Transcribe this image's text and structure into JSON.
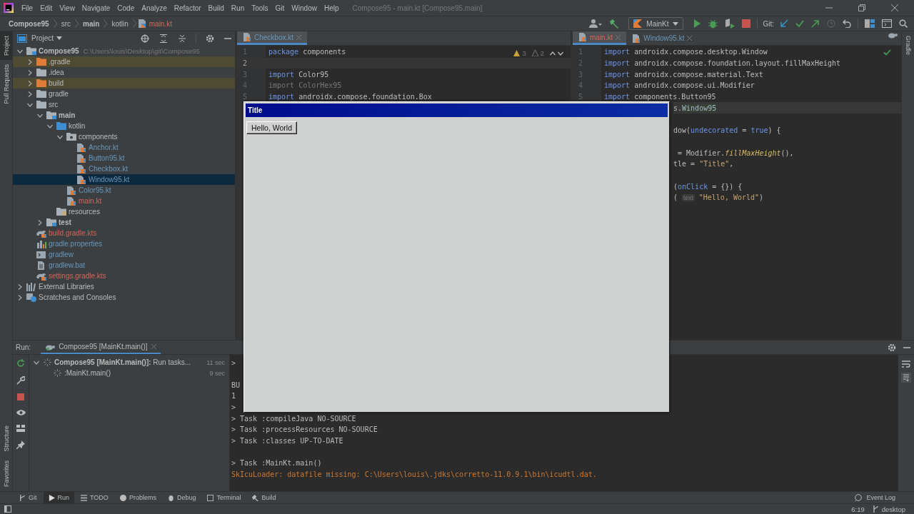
{
  "menu_bar": {
    "items": [
      "File",
      "Edit",
      "View",
      "Navigate",
      "Code",
      "Analyze",
      "Refactor",
      "Build",
      "Run",
      "Tools",
      "Git",
      "Window",
      "Help"
    ],
    "title": "Compose95 - main.kt [Compose95.main]"
  },
  "breadcrumbs": [
    {
      "label": "Compose95",
      "kind": "project"
    },
    {
      "label": "src",
      "kind": "dir"
    },
    {
      "label": "main",
      "kind": "module"
    },
    {
      "label": "kotlin",
      "kind": "dir"
    },
    {
      "label": "main.kt",
      "kind": "file"
    }
  ],
  "toolbar": {
    "run_config": "MainKt",
    "git_label": "Git:"
  },
  "side_stripe": {
    "top": [
      {
        "label": "Project",
        "selected": true
      },
      {
        "label": "Pull Requests",
        "selected": false
      }
    ],
    "bottom": [
      {
        "label": "Structure",
        "selected": false
      },
      {
        "label": "Favorites",
        "selected": false
      }
    ],
    "right": [
      {
        "label": "Gradle",
        "selected": false
      }
    ]
  },
  "project": {
    "title": "Project",
    "tree": [
      {
        "name": "Compose95",
        "kind": "module",
        "path": "C:\\Users\\louis\\Desktop\\git\\Compose95",
        "expanded": true,
        "changed": false,
        "unversioned": false,
        "selected": false,
        "excluded": false,
        "children": [
          {
            "name": ".gradle",
            "kind": "folder-excluded",
            "expanded": false,
            "changed": false,
            "unversioned": false,
            "selected": false,
            "excluded": true
          },
          {
            "name": ".idea",
            "kind": "folder",
            "expanded": false,
            "changed": false,
            "unversioned": false,
            "selected": false,
            "excluded": false
          },
          {
            "name": "build",
            "kind": "folder-excluded",
            "expanded": false,
            "changed": false,
            "unversioned": false,
            "selected": false,
            "excluded": true
          },
          {
            "name": "gradle",
            "kind": "folder",
            "expanded": false,
            "changed": false,
            "unversioned": false,
            "selected": false,
            "excluded": false
          },
          {
            "name": "src",
            "kind": "folder",
            "expanded": true,
            "changed": false,
            "unversioned": false,
            "selected": false,
            "excluded": false,
            "children": [
              {
                "name": "main",
                "kind": "module",
                "expanded": true,
                "changed": false,
                "unversioned": false,
                "selected": false,
                "excluded": false,
                "children": [
                  {
                    "name": "kotlin",
                    "kind": "source-folder",
                    "expanded": true,
                    "changed": false,
                    "unversioned": false,
                    "selected": false,
                    "excluded": false,
                    "children": [
                      {
                        "name": "components",
                        "kind": "package",
                        "expanded": true,
                        "changed": false,
                        "unversioned": false,
                        "selected": false,
                        "excluded": false,
                        "children": [
                          {
                            "name": "Anchor.kt",
                            "kind": "kotlin",
                            "changed": true,
                            "unversioned": false,
                            "selected": false,
                            "excluded": false
                          },
                          {
                            "name": "Button95.kt",
                            "kind": "kotlin",
                            "changed": true,
                            "unversioned": false,
                            "selected": false,
                            "excluded": false
                          },
                          {
                            "name": "Checkbox.kt",
                            "kind": "kotlin",
                            "changed": true,
                            "unversioned": false,
                            "selected": false,
                            "excluded": false
                          },
                          {
                            "name": "Window95.kt",
                            "kind": "kotlin",
                            "changed": true,
                            "unversioned": false,
                            "selected": true,
                            "excluded": false
                          }
                        ]
                      },
                      {
                        "name": "Color95.kt",
                        "kind": "kotlin",
                        "changed": true,
                        "unversioned": false,
                        "selected": false,
                        "excluded": false
                      },
                      {
                        "name": "main.kt",
                        "kind": "kotlin",
                        "changed": false,
                        "unversioned": true,
                        "selected": false,
                        "excluded": false
                      }
                    ]
                  },
                  {
                    "name": "resources",
                    "kind": "resources-folder",
                    "changed": false,
                    "unversioned": false,
                    "selected": false,
                    "excluded": false
                  }
                ]
              },
              {
                "name": "test",
                "kind": "module",
                "expanded": false,
                "changed": false,
                "unversioned": false,
                "selected": false,
                "excluded": false
              }
            ]
          },
          {
            "name": "build.gradle.kts",
            "kind": "gradle",
            "changed": false,
            "unversioned": true,
            "selected": false,
            "excluded": false
          },
          {
            "name": "gradle.properties",
            "kind": "properties",
            "changed": true,
            "unversioned": false,
            "selected": false,
            "excluded": false
          },
          {
            "name": "gradlew",
            "kind": "shell",
            "changed": true,
            "unversioned": false,
            "selected": false,
            "excluded": false
          },
          {
            "name": "gradlew.bat",
            "kind": "bat",
            "changed": true,
            "unversioned": false,
            "selected": false,
            "excluded": false
          },
          {
            "name": "settings.gradle.kts",
            "kind": "gradle",
            "changed": false,
            "unversioned": true,
            "selected": false,
            "excluded": false
          }
        ]
      },
      {
        "name": "External Libraries",
        "kind": "libraries",
        "expanded": false,
        "changed": false,
        "unversioned": false,
        "selected": false,
        "excluded": false
      },
      {
        "name": "Scratches and Consoles",
        "kind": "scratches",
        "expanded": false,
        "changed": false,
        "unversioned": false,
        "selected": false,
        "excluded": false
      }
    ]
  },
  "editors": [
    {
      "tabs": [
        {
          "label": "Checkbox.kt",
          "changed": true,
          "unversioned": false,
          "selected": true
        }
      ],
      "inspections": {
        "warnings": "3",
        "weak_warnings": "2"
      },
      "lines": [
        {
          "number": "1",
          "kind": "full",
          "current": false,
          "segments": [
            {
              "text": "package",
              "kind": "kw"
            },
            {
              "text": " components",
              "kind": "plain"
            }
          ]
        },
        {
          "number": "2",
          "kind": "full",
          "current": true
        },
        {
          "number": "3",
          "kind": "full",
          "current": false,
          "segments": [
            {
              "text": "import",
              "kind": "kw"
            },
            {
              "text": " Color95",
              "kind": "plain"
            }
          ]
        },
        {
          "number": "4",
          "kind": "full",
          "current": false,
          "segments": [
            {
              "text": "import ColorHex95",
              "kind": "dim"
            }
          ]
        },
        {
          "number": "5",
          "kind": "full",
          "current": false,
          "segments": [
            {
              "text": "import",
              "kind": "kw"
            },
            {
              "text": " androidx.compose.foundation.Box",
              "kind": "plain"
            }
          ]
        }
      ]
    },
    {
      "tabs": [
        {
          "label": "main.kt",
          "changed": false,
          "unversioned": true,
          "selected": true
        },
        {
          "label": "Window95.kt",
          "changed": true,
          "unversioned": false,
          "selected": false
        }
      ],
      "lines": [
        {
          "number": "1",
          "kind": "full",
          "current": false,
          "segments": [
            {
              "text": "import",
              "kind": "kw"
            },
            {
              "text": " androidx.compose.desktop.Window",
              "kind": "plain"
            }
          ]
        },
        {
          "number": "2",
          "kind": "full",
          "current": false,
          "segments": [
            {
              "text": "import",
              "kind": "kw"
            },
            {
              "text": " androidx.compose.foundation.layout.fillMaxHeight",
              "kind": "plain"
            }
          ]
        },
        {
          "number": "3",
          "kind": "full",
          "current": false,
          "segments": [
            {
              "text": "import",
              "kind": "kw"
            },
            {
              "text": " androidx.compose.material.Text",
              "kind": "plain"
            }
          ]
        },
        {
          "number": "4",
          "kind": "full",
          "current": false,
          "segments": [
            {
              "text": "import",
              "kind": "kw"
            },
            {
              "text": " androidx.compose.ui.Modifier",
              "kind": "plain"
            }
          ]
        },
        {
          "number": "5",
          "kind": "full",
          "current": false,
          "segments": [
            {
              "text": "import",
              "kind": "kw"
            },
            {
              "text": " components.Button95",
              "kind": "plain"
            }
          ]
        },
        {
          "kind": "partial",
          "current": true,
          "segments": [
            {
              "text": "s.",
              "kind": "plain"
            },
            {
              "text": "Window95",
              "kind": "sel"
            }
          ]
        },
        {
          "kind": "partial",
          "current": false
        },
        {
          "kind": "partial",
          "current": false,
          "segments": [
            {
              "text": "dow(",
              "kind": "plain"
            },
            {
              "text": "undecorated",
              "kind": "param"
            },
            {
              "text": " = ",
              "kind": "plain"
            },
            {
              "text": "true",
              "kind": "kw"
            },
            {
              "text": ") {",
              "kind": "plain"
            }
          ]
        },
        {
          "kind": "partial",
          "current": false
        },
        {
          "kind": "partial",
          "current": false,
          "segments": [
            {
              "text": " = Modifier.",
              "kind": "plain"
            },
            {
              "text": "fillMaxHeight",
              "kind": "fn"
            },
            {
              "text": "(),",
              "kind": "plain"
            }
          ]
        },
        {
          "kind": "partial",
          "current": false,
          "segments": [
            {
              "text": "tle = ",
              "kind": "plain"
            },
            {
              "text": "\"Title\"",
              "kind": "str"
            },
            {
              "text": ",",
              "kind": "plain"
            }
          ]
        },
        {
          "kind": "partial",
          "current": false
        },
        {
          "kind": "partial",
          "current": false,
          "segments": [
            {
              "text": "(",
              "kind": "plain"
            },
            {
              "text": "onClick",
              "kind": "param"
            },
            {
              "text": " = {}) {",
              "kind": "plain"
            }
          ]
        },
        {
          "kind": "partial",
          "current": false,
          "segments": [
            {
              "text": "( ",
              "kind": "plain"
            },
            {
              "text": "text",
              "kind": "hint"
            },
            {
              "text": " \"Hello, World\"",
              "kind": "str"
            },
            {
              "text": ")",
              "kind": "plain"
            }
          ]
        }
      ]
    }
  ],
  "run": {
    "label": "Run:",
    "tab": {
      "label": "Compose95 [MainKt.main()]",
      "selected": true
    },
    "tasks": [
      {
        "text": "**Compose95 [MainKt.main()]:** Run tasks...",
        "time": "11 sec",
        "expanded": true,
        "children": [
          {
            "text": ":MainKt.main()",
            "time": "9 sec"
          }
        ]
      }
    ],
    "console": [
      {
        "kind": "out",
        "text": ">"
      },
      {
        "kind": "blank"
      },
      {
        "kind": "out",
        "text": "BU"
      },
      {
        "kind": "out",
        "text": "1"
      },
      {
        "kind": "out",
        "text": ">"
      },
      {
        "kind": "out",
        "text": "> Task :compileJava NO-SOURCE"
      },
      {
        "kind": "out",
        "text": "> Task :processResources NO-SOURCE"
      },
      {
        "kind": "out",
        "text": "> Task :classes UP-TO-DATE"
      },
      {
        "kind": "blank"
      },
      {
        "kind": "out",
        "text": "> Task :MainKt.main()"
      },
      {
        "kind": "error",
        "text": "SkIcuLoader: datafile missing: C:\\Users\\louis\\.jdks\\corretto-11.0.9.1\\bin\\icudtl.dat."
      }
    ]
  },
  "tool_tabs": [
    {
      "label": "Git",
      "selected": false
    },
    {
      "label": "Run",
      "selected": true
    },
    {
      "label": "TODO",
      "selected": false
    },
    {
      "label": "Problems",
      "selected": false
    },
    {
      "label": "Debug",
      "selected": false
    },
    {
      "label": "Terminal",
      "selected": false
    },
    {
      "label": "Build",
      "selected": false
    }
  ],
  "status_bar": {
    "event_log": "Event Log",
    "position": "6:19",
    "branch": "desktop"
  },
  "app_window": {
    "title": "Title",
    "button": "Hello, World"
  }
}
